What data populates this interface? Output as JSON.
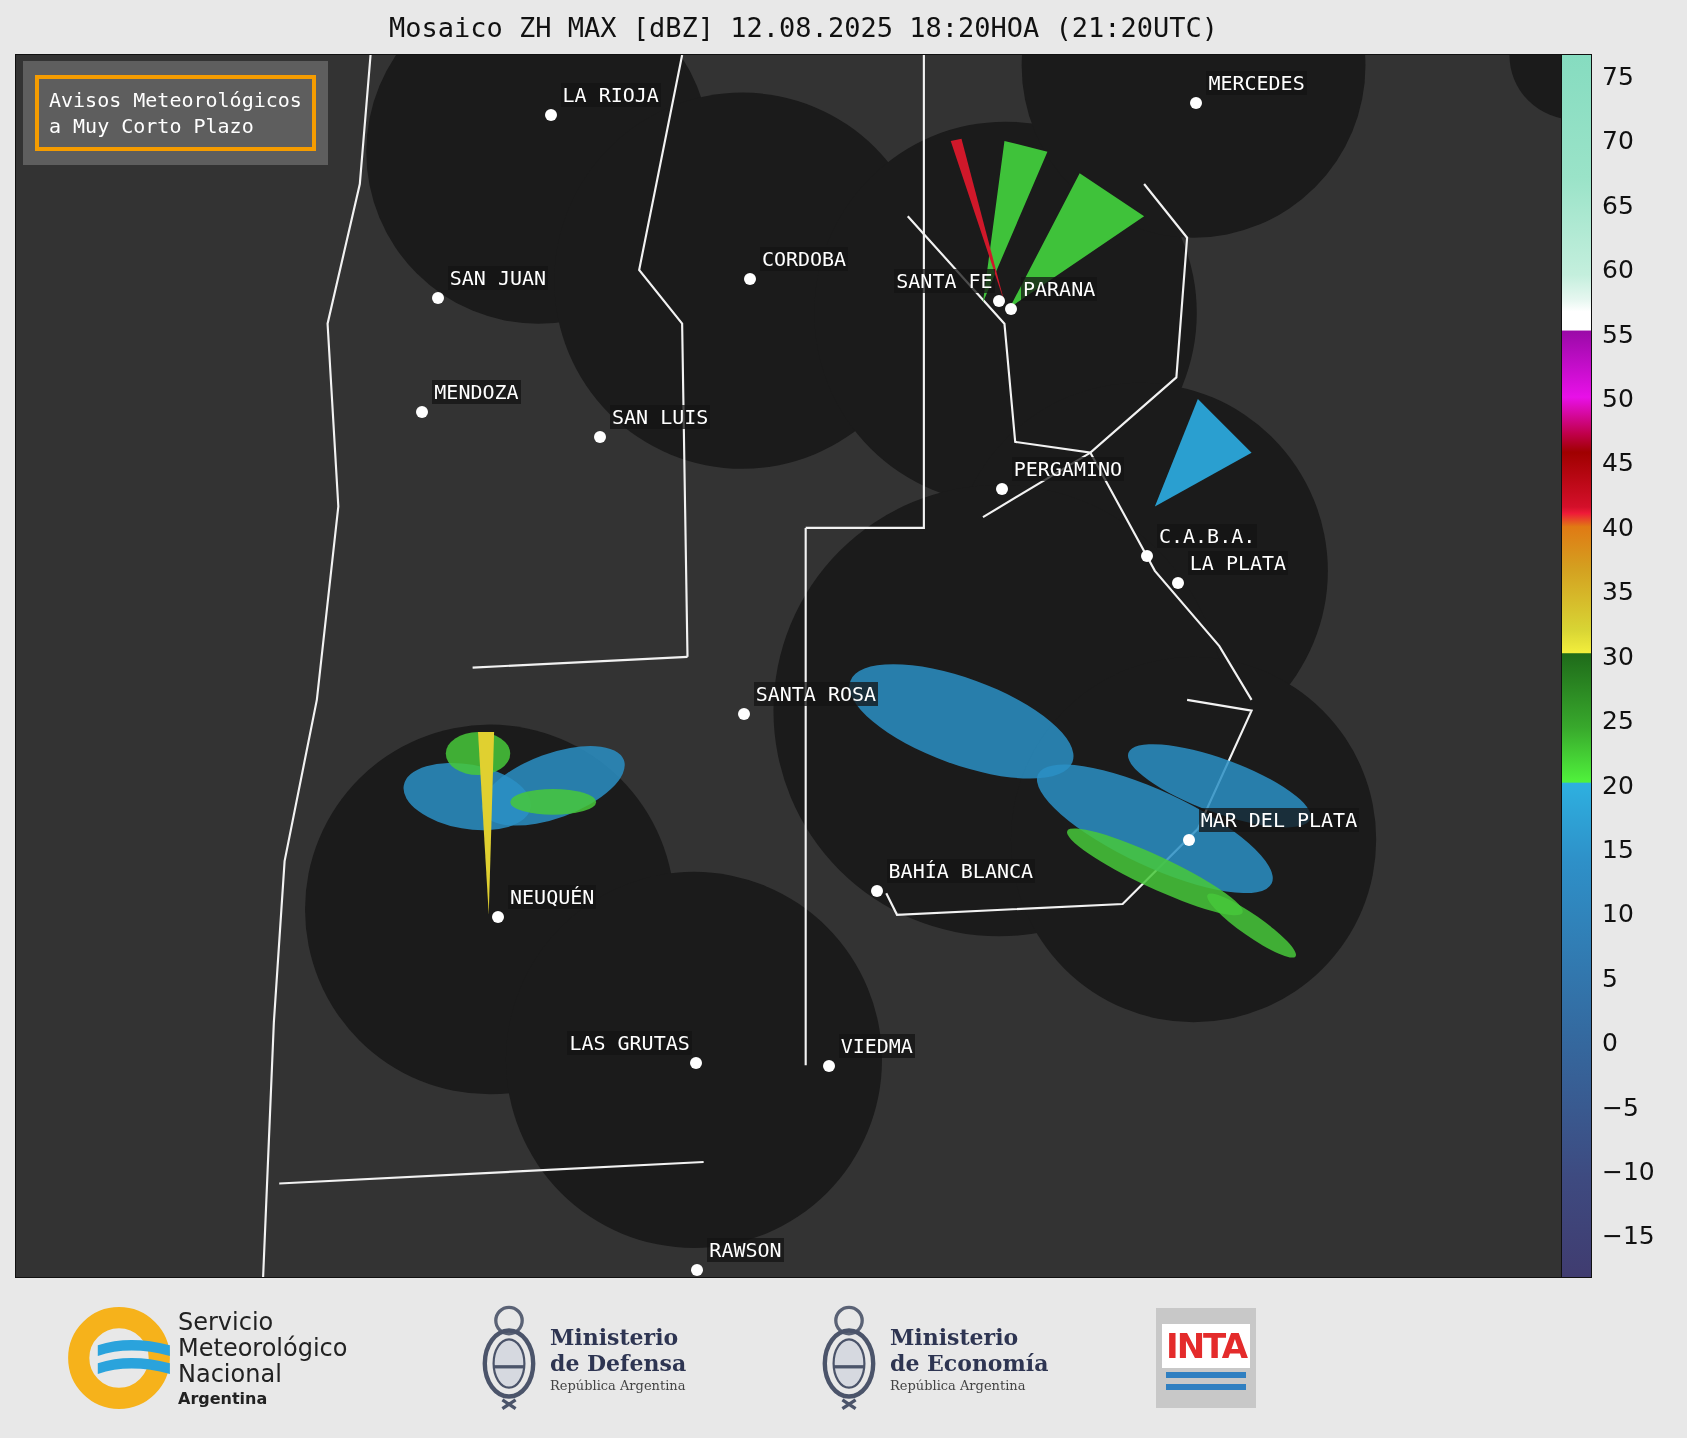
{
  "title": "Mosaico ZH MAX [dBZ] 12.08.2025 18:20HOA (21:20UTC)",
  "alert_box": {
    "lines": [
      "Avisos Meteorológicos",
      "a Muy Corto Plazo"
    ]
  },
  "cities": [
    {
      "name": "LA RIOJA"
    },
    {
      "name": "MERCEDES"
    },
    {
      "name": "CORDOBA"
    },
    {
      "name": "SAN JUAN"
    },
    {
      "name": "SANTA FE"
    },
    {
      "name": "PARANA"
    },
    {
      "name": "MENDOZA"
    },
    {
      "name": "SAN LUIS"
    },
    {
      "name": "PERGAMINO"
    },
    {
      "name": "C.A.B.A."
    },
    {
      "name": "LA PLATA"
    },
    {
      "name": "SANTA ROSA"
    },
    {
      "name": "MAR DEL PLATA"
    },
    {
      "name": "BAHÍA BLANCA"
    },
    {
      "name": "NEUQUÉN"
    },
    {
      "name": "LAS GRUTAS"
    },
    {
      "name": "VIEDMA"
    },
    {
      "name": "RAWSON"
    }
  ],
  "colorbar": {
    "ticks": [
      "75",
      "70",
      "65",
      "60",
      "55",
      "50",
      "45",
      "40",
      "35",
      "30",
      "25",
      "20",
      "15",
      "10",
      "5",
      "0",
      "−5",
      "−10",
      "−15"
    ]
  },
  "footer": {
    "smn": {
      "lines": [
        "Servicio",
        "Meteorológico",
        "Nacional"
      ],
      "country": "Argentina"
    },
    "ministries": [
      {
        "line1": "Ministerio",
        "line2": "de Defensa",
        "country": "República Argentina"
      },
      {
        "line1": "Ministerio",
        "line2": "de Economía",
        "country": "República Argentina"
      }
    ],
    "inta": "INTA"
  }
}
